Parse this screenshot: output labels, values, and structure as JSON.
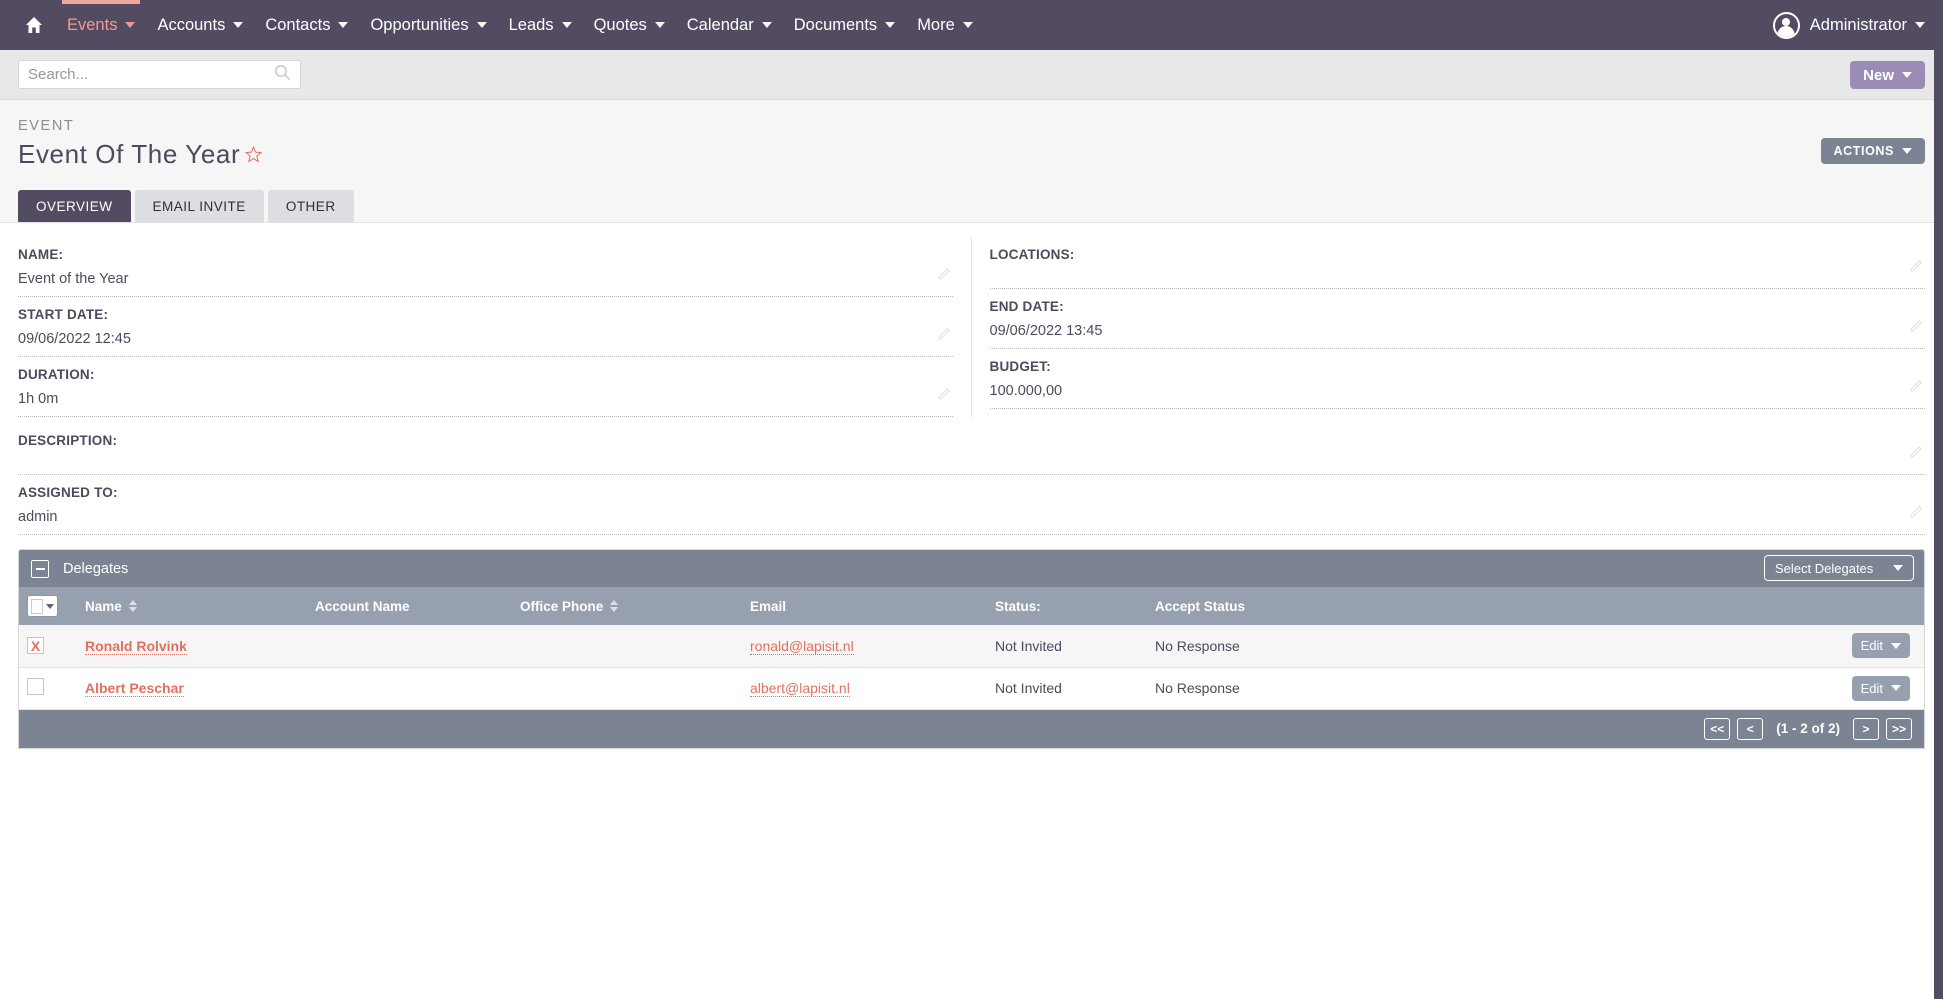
{
  "topnav": {
    "home_icon": "home-icon",
    "items": [
      {
        "label": "Events",
        "active": true
      },
      {
        "label": "Accounts",
        "active": false
      },
      {
        "label": "Contacts",
        "active": false
      },
      {
        "label": "Opportunities",
        "active": false
      },
      {
        "label": "Leads",
        "active": false
      },
      {
        "label": "Quotes",
        "active": false
      },
      {
        "label": "Calendar",
        "active": false
      },
      {
        "label": "Documents",
        "active": false
      },
      {
        "label": "More",
        "active": false
      }
    ],
    "user": "Administrator",
    "accent_active": "#f09c8f",
    "bar_color": "#534b62"
  },
  "search": {
    "placeholder": "Search...",
    "value": "",
    "icon": "search-icon"
  },
  "new_button": {
    "label": "New",
    "color": "#9b8cb5"
  },
  "record": {
    "module_label": "EVENT",
    "title": "Event Of The Year",
    "favorite_icon": "star-outline-icon",
    "actions_label": "ACTIONS"
  },
  "tabs": [
    {
      "label": "OVERVIEW",
      "active": true
    },
    {
      "label": "EMAIL INVITE",
      "active": false
    },
    {
      "label": "OTHER",
      "active": false
    }
  ],
  "fields": {
    "left": [
      {
        "label": "NAME:",
        "value": "Event of the Year"
      },
      {
        "label": "START DATE:",
        "value": "09/06/2022 12:45"
      },
      {
        "label": "DURATION:",
        "value": "1h 0m"
      }
    ],
    "right": [
      {
        "label": "LOCATIONS:",
        "value": ""
      },
      {
        "label": "END DATE:",
        "value": "09/06/2022 13:45"
      },
      {
        "label": "BUDGET:",
        "value": "100.000,00"
      }
    ],
    "full": [
      {
        "label": "DESCRIPTION:",
        "value": ""
      },
      {
        "label": "ASSIGNED TO:",
        "value": "admin"
      }
    ]
  },
  "delegates_panel": {
    "title": "Delegates",
    "collapse_icon": "minus-icon",
    "select_button": "Select Delegates",
    "columns": [
      {
        "label": "",
        "sortable": false,
        "key": "check"
      },
      {
        "label": "Name",
        "sortable": true,
        "key": "name"
      },
      {
        "label": "Account Name",
        "sortable": false,
        "key": "account"
      },
      {
        "label": "Office Phone",
        "sortable": true,
        "key": "phone"
      },
      {
        "label": "Email",
        "sortable": false,
        "key": "email"
      },
      {
        "label": "Status:",
        "sortable": false,
        "key": "status"
      },
      {
        "label": "Accept Status",
        "sortable": false,
        "key": "accept"
      },
      {
        "label": "",
        "sortable": false,
        "key": "actions"
      }
    ],
    "rows": [
      {
        "checked": true,
        "check_mark": "X",
        "name": "Ronald Rolvink",
        "account": "",
        "phone": "",
        "email": "ronald@lapisit.nl",
        "status": "Not Invited",
        "accept": "No Response",
        "edit_label": "Edit"
      },
      {
        "checked": false,
        "check_mark": "",
        "name": "Albert Peschar",
        "account": "",
        "phone": "",
        "email": "albert@lapisit.nl",
        "status": "Not Invited",
        "accept": "No Response",
        "edit_label": "Edit"
      }
    ],
    "pagination": {
      "first": "<<",
      "prev": "<",
      "label": "(1 - 2 of 2)",
      "next": ">",
      "last": ">>"
    }
  },
  "colors": {
    "nav": "#534b62",
    "panel_header": "#7c8494",
    "table_header": "#97a0ae",
    "link": "#e2705f",
    "accent_purple": "#9b8cb5"
  }
}
